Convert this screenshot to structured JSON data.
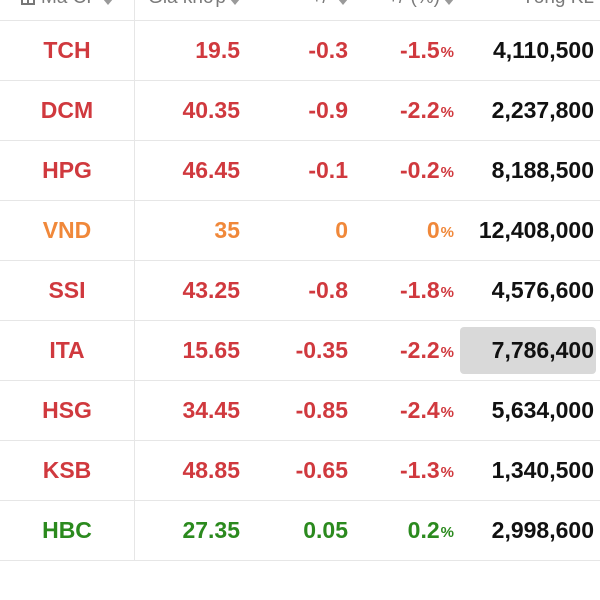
{
  "colors": {
    "down": "#d0393e",
    "flat": "#f0883a",
    "up": "#2b8a1e",
    "volume": "#111111"
  },
  "header": {
    "symbol": "Mã CP",
    "price": "Giá khớp",
    "change": "+/-",
    "change_pct": "+/-(%)",
    "volume": "Tổng KL"
  },
  "rows": [
    {
      "symbol": "TCH",
      "price": "19.5",
      "change": "-0.3",
      "pct": "-1.5",
      "pct_sign": "%",
      "volume": "4,110,500",
      "trend": "down"
    },
    {
      "symbol": "DCM",
      "price": "40.35",
      "change": "-0.9",
      "pct": "-2.2",
      "pct_sign": "%",
      "volume": "2,237,800",
      "trend": "down"
    },
    {
      "symbol": "HPG",
      "price": "46.45",
      "change": "-0.1",
      "pct": "-0.2",
      "pct_sign": "%",
      "volume": "8,188,500",
      "trend": "down"
    },
    {
      "symbol": "VND",
      "price": "35",
      "change": "0",
      "pct": "0",
      "pct_sign": "%",
      "volume": "12,408,000",
      "trend": "flat"
    },
    {
      "symbol": "SSI",
      "price": "43.25",
      "change": "-0.8",
      "pct": "-1.8",
      "pct_sign": "%",
      "volume": "4,576,600",
      "trend": "down"
    },
    {
      "symbol": "ITA",
      "price": "15.65",
      "change": "-0.35",
      "pct": "-2.2",
      "pct_sign": "%",
      "volume": "7,786,400",
      "trend": "down",
      "highlighted": true
    },
    {
      "symbol": "HSG",
      "price": "34.45",
      "change": "-0.85",
      "pct": "-2.4",
      "pct_sign": "%",
      "volume": "5,634,000",
      "trend": "down"
    },
    {
      "symbol": "KSB",
      "price": "48.85",
      "change": "-0.65",
      "pct": "-1.3",
      "pct_sign": "%",
      "volume": "1,340,500",
      "trend": "down"
    },
    {
      "symbol": "HBC",
      "price": "27.35",
      "change": "0.05",
      "pct": "0.2",
      "pct_sign": "%",
      "volume": "2,998,600",
      "trend": "up"
    }
  ],
  "icons": {
    "header_leading": "table-icon",
    "sort": "sort-icon"
  }
}
